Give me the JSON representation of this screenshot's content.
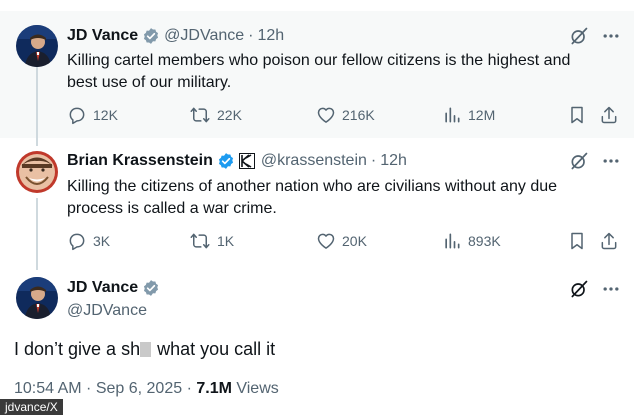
{
  "tweets": [
    {
      "name": "JD Vance",
      "handle": "@JDVance",
      "dot": "·",
      "time": "12h",
      "text_line1": "Killing cartel members who poison our fellow citizens is the highest and",
      "text_line2": "best use of our military.",
      "replies": "12K",
      "reposts": "22K",
      "likes": "216K",
      "views": "12M"
    },
    {
      "name": "Brian Krassenstein",
      "handle": "@krassenstein",
      "dot": "·",
      "time": "12h",
      "text_line1": "Killing the citizens of another nation who are civilians without any due",
      "text_line2": "process is called a war crime.",
      "replies": "3K",
      "reposts": "1K",
      "likes": "20K",
      "views": "893K"
    }
  ],
  "main_tweet": {
    "name": "JD Vance",
    "handle": "@JDVance",
    "text_before": "I don’t give a sh",
    "text_after": " what you call it",
    "timestamp": "10:54 AM · Sep 6, 2025 · ",
    "views_count": "7.1M",
    "views_label": " Views"
  },
  "credit": "jdvance/X",
  "colors": {
    "verified": "#1d9bf0",
    "secondary_text": "#536471",
    "primary_text": "#0f1419",
    "highlight_bg": "#f7f9f9",
    "thread_line": "#cfd9de"
  },
  "icons": [
    "verified-badge-icon",
    "affiliate-k-icon",
    "reply-icon",
    "repost-icon",
    "like-icon",
    "views-icon",
    "bookmark-icon",
    "share-icon",
    "grok-icon",
    "more-icon"
  ]
}
